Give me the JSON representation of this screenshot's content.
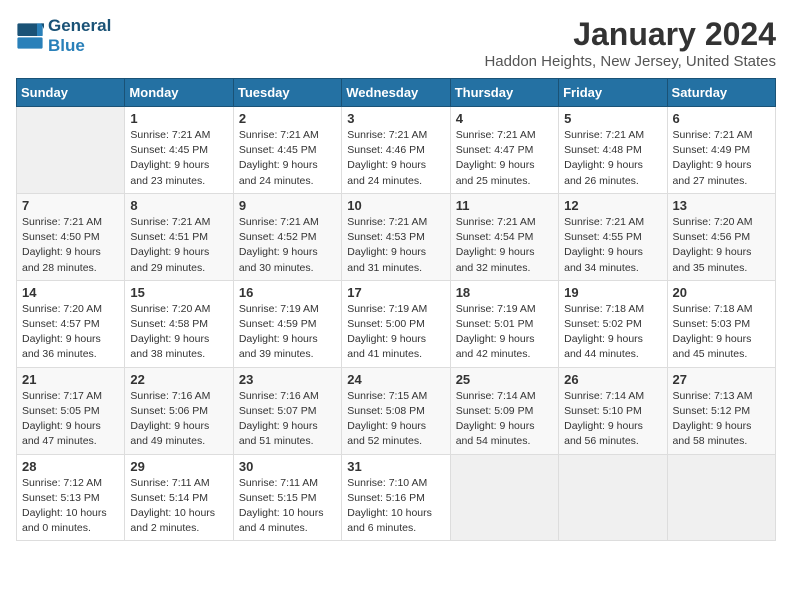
{
  "header": {
    "logo_line1": "General",
    "logo_line2": "Blue",
    "month_title": "January 2024",
    "location": "Haddon Heights, New Jersey, United States"
  },
  "days_of_week": [
    "Sunday",
    "Monday",
    "Tuesday",
    "Wednesday",
    "Thursday",
    "Friday",
    "Saturday"
  ],
  "weeks": [
    [
      {
        "day": "",
        "sunrise": "",
        "sunset": "",
        "daylight": ""
      },
      {
        "day": "1",
        "sunrise": "Sunrise: 7:21 AM",
        "sunset": "Sunset: 4:45 PM",
        "daylight": "Daylight: 9 hours and 23 minutes."
      },
      {
        "day": "2",
        "sunrise": "Sunrise: 7:21 AM",
        "sunset": "Sunset: 4:45 PM",
        "daylight": "Daylight: 9 hours and 24 minutes."
      },
      {
        "day": "3",
        "sunrise": "Sunrise: 7:21 AM",
        "sunset": "Sunset: 4:46 PM",
        "daylight": "Daylight: 9 hours and 24 minutes."
      },
      {
        "day": "4",
        "sunrise": "Sunrise: 7:21 AM",
        "sunset": "Sunset: 4:47 PM",
        "daylight": "Daylight: 9 hours and 25 minutes."
      },
      {
        "day": "5",
        "sunrise": "Sunrise: 7:21 AM",
        "sunset": "Sunset: 4:48 PM",
        "daylight": "Daylight: 9 hours and 26 minutes."
      },
      {
        "day": "6",
        "sunrise": "Sunrise: 7:21 AM",
        "sunset": "Sunset: 4:49 PM",
        "daylight": "Daylight: 9 hours and 27 minutes."
      }
    ],
    [
      {
        "day": "7",
        "sunrise": "Sunrise: 7:21 AM",
        "sunset": "Sunset: 4:50 PM",
        "daylight": "Daylight: 9 hours and 28 minutes."
      },
      {
        "day": "8",
        "sunrise": "Sunrise: 7:21 AM",
        "sunset": "Sunset: 4:51 PM",
        "daylight": "Daylight: 9 hours and 29 minutes."
      },
      {
        "day": "9",
        "sunrise": "Sunrise: 7:21 AM",
        "sunset": "Sunset: 4:52 PM",
        "daylight": "Daylight: 9 hours and 30 minutes."
      },
      {
        "day": "10",
        "sunrise": "Sunrise: 7:21 AM",
        "sunset": "Sunset: 4:53 PM",
        "daylight": "Daylight: 9 hours and 31 minutes."
      },
      {
        "day": "11",
        "sunrise": "Sunrise: 7:21 AM",
        "sunset": "Sunset: 4:54 PM",
        "daylight": "Daylight: 9 hours and 32 minutes."
      },
      {
        "day": "12",
        "sunrise": "Sunrise: 7:21 AM",
        "sunset": "Sunset: 4:55 PM",
        "daylight": "Daylight: 9 hours and 34 minutes."
      },
      {
        "day": "13",
        "sunrise": "Sunrise: 7:20 AM",
        "sunset": "Sunset: 4:56 PM",
        "daylight": "Daylight: 9 hours and 35 minutes."
      }
    ],
    [
      {
        "day": "14",
        "sunrise": "Sunrise: 7:20 AM",
        "sunset": "Sunset: 4:57 PM",
        "daylight": "Daylight: 9 hours and 36 minutes."
      },
      {
        "day": "15",
        "sunrise": "Sunrise: 7:20 AM",
        "sunset": "Sunset: 4:58 PM",
        "daylight": "Daylight: 9 hours and 38 minutes."
      },
      {
        "day": "16",
        "sunrise": "Sunrise: 7:19 AM",
        "sunset": "Sunset: 4:59 PM",
        "daylight": "Daylight: 9 hours and 39 minutes."
      },
      {
        "day": "17",
        "sunrise": "Sunrise: 7:19 AM",
        "sunset": "Sunset: 5:00 PM",
        "daylight": "Daylight: 9 hours and 41 minutes."
      },
      {
        "day": "18",
        "sunrise": "Sunrise: 7:19 AM",
        "sunset": "Sunset: 5:01 PM",
        "daylight": "Daylight: 9 hours and 42 minutes."
      },
      {
        "day": "19",
        "sunrise": "Sunrise: 7:18 AM",
        "sunset": "Sunset: 5:02 PM",
        "daylight": "Daylight: 9 hours and 44 minutes."
      },
      {
        "day": "20",
        "sunrise": "Sunrise: 7:18 AM",
        "sunset": "Sunset: 5:03 PM",
        "daylight": "Daylight: 9 hours and 45 minutes."
      }
    ],
    [
      {
        "day": "21",
        "sunrise": "Sunrise: 7:17 AM",
        "sunset": "Sunset: 5:05 PM",
        "daylight": "Daylight: 9 hours and 47 minutes."
      },
      {
        "day": "22",
        "sunrise": "Sunrise: 7:16 AM",
        "sunset": "Sunset: 5:06 PM",
        "daylight": "Daylight: 9 hours and 49 minutes."
      },
      {
        "day": "23",
        "sunrise": "Sunrise: 7:16 AM",
        "sunset": "Sunset: 5:07 PM",
        "daylight": "Daylight: 9 hours and 51 minutes."
      },
      {
        "day": "24",
        "sunrise": "Sunrise: 7:15 AM",
        "sunset": "Sunset: 5:08 PM",
        "daylight": "Daylight: 9 hours and 52 minutes."
      },
      {
        "day": "25",
        "sunrise": "Sunrise: 7:14 AM",
        "sunset": "Sunset: 5:09 PM",
        "daylight": "Daylight: 9 hours and 54 minutes."
      },
      {
        "day": "26",
        "sunrise": "Sunrise: 7:14 AM",
        "sunset": "Sunset: 5:10 PM",
        "daylight": "Daylight: 9 hours and 56 minutes."
      },
      {
        "day": "27",
        "sunrise": "Sunrise: 7:13 AM",
        "sunset": "Sunset: 5:12 PM",
        "daylight": "Daylight: 9 hours and 58 minutes."
      }
    ],
    [
      {
        "day": "28",
        "sunrise": "Sunrise: 7:12 AM",
        "sunset": "Sunset: 5:13 PM",
        "daylight": "Daylight: 10 hours and 0 minutes."
      },
      {
        "day": "29",
        "sunrise": "Sunrise: 7:11 AM",
        "sunset": "Sunset: 5:14 PM",
        "daylight": "Daylight: 10 hours and 2 minutes."
      },
      {
        "day": "30",
        "sunrise": "Sunrise: 7:11 AM",
        "sunset": "Sunset: 5:15 PM",
        "daylight": "Daylight: 10 hours and 4 minutes."
      },
      {
        "day": "31",
        "sunrise": "Sunrise: 7:10 AM",
        "sunset": "Sunset: 5:16 PM",
        "daylight": "Daylight: 10 hours and 6 minutes."
      },
      {
        "day": "",
        "sunrise": "",
        "sunset": "",
        "daylight": ""
      },
      {
        "day": "",
        "sunrise": "",
        "sunset": "",
        "daylight": ""
      },
      {
        "day": "",
        "sunrise": "",
        "sunset": "",
        "daylight": ""
      }
    ]
  ]
}
